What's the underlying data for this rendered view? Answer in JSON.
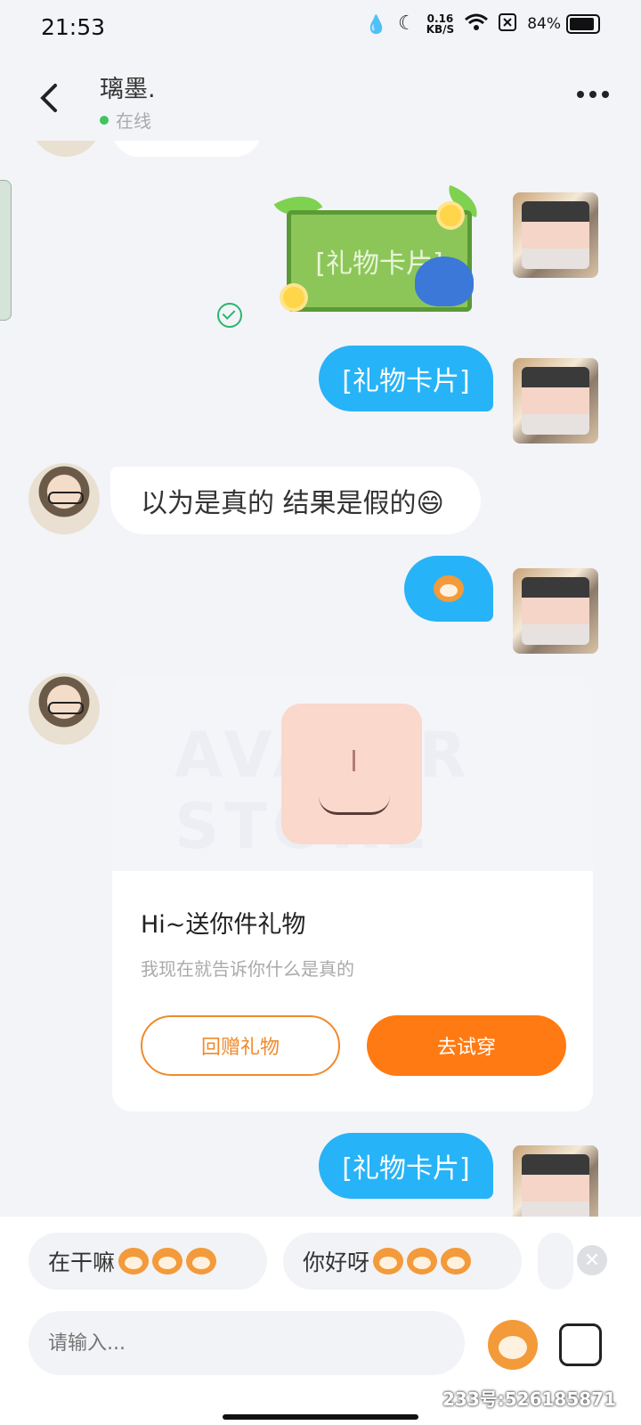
{
  "status_bar": {
    "time": "21:53",
    "speed_value": "0.16",
    "speed_unit": "KB/S",
    "battery": "84%"
  },
  "header": {
    "name": "璃墨.",
    "status": "在线"
  },
  "messages": {
    "gift_card_sticker_text": "[礼物卡片]",
    "msg_gift_card_1": "[礼物卡片]",
    "msg_other_text": "以为是真的 结果是假的😄",
    "msg_gift_card_2": "[礼物卡片]"
  },
  "gift_card": {
    "watermark": "AVATAR STORE",
    "title": "Hi~送你件礼物",
    "subtitle": "我现在就告诉你什么是真的",
    "return_gift_label": "回赠礼物",
    "try_on_label": "去试穿"
  },
  "quick_replies": [
    {
      "text": "在干嘛"
    },
    {
      "text": "你好呀"
    }
  ],
  "input": {
    "placeholder": "请输入..."
  },
  "watermark": "233号:526185871",
  "colors": {
    "accent_blue": "#27b3f7",
    "accent_orange": "#ff7a12",
    "online_green": "#3cc65c"
  }
}
